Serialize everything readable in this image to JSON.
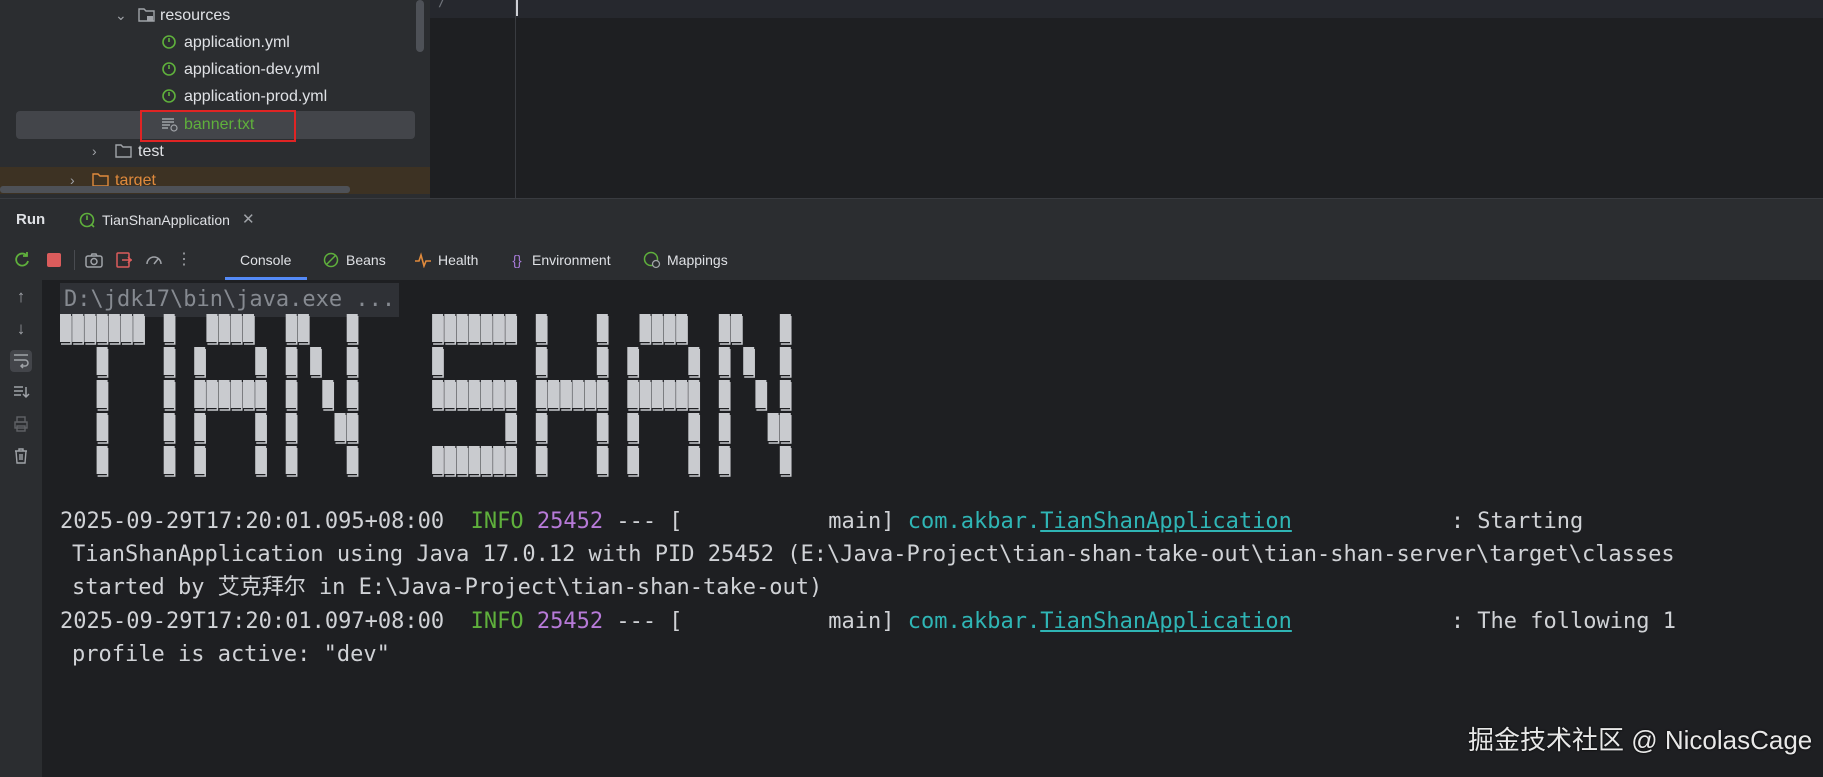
{
  "project_tree": {
    "items": [
      {
        "label": "resources",
        "kind": "folder-resources"
      },
      {
        "label": "application.yml",
        "kind": "yaml"
      },
      {
        "label": "application-dev.yml",
        "kind": "yaml"
      },
      {
        "label": "application-prod.yml",
        "kind": "yaml"
      },
      {
        "label": "banner.txt",
        "kind": "text",
        "selected": true
      },
      {
        "label": "test",
        "kind": "folder"
      },
      {
        "label": "target",
        "kind": "folder-excluded"
      }
    ]
  },
  "editor": {
    "first_char": "/"
  },
  "run_window": {
    "title": "Run",
    "tab_label": "TianShanApplication",
    "tool_tabs": [
      {
        "label": "Console",
        "icon": "console",
        "active": true
      },
      {
        "label": "Beans",
        "icon": "beans-icon"
      },
      {
        "label": "Health",
        "icon": "health-icon"
      },
      {
        "label": "Environment",
        "icon": "environment-icon"
      },
      {
        "label": "Mappings",
        "icon": "mappings-icon"
      }
    ]
  },
  "console": {
    "command": "D:\\jdk17\\bin\\java.exe ...",
    "banner_text": "TIAN SHAN",
    "log": [
      {
        "ts": "2025-09-29T17:20:01.095+08:00",
        "level": "INFO",
        "pid": "25452",
        "sep": "--- [",
        "thread": "           main]",
        "logger_pkg": "com.akbar.",
        "logger_class": "TianShanApplication",
        "msg": ": Starting"
      },
      {
        "cont": "TianShanApplication using Java 17.0.12 with PID 25452 (E:\\Java-Project\\tian-shan-take-out\\tian-shan-server\\target\\classes"
      },
      {
        "cont": "started by 艾克拜尔 in E:\\Java-Project\\tian-shan-take-out)"
      },
      {
        "ts": "2025-09-29T17:20:01.097+08:00",
        "level": "INFO",
        "pid": "25452",
        "sep": "--- [",
        "thread": "           main]",
        "logger_pkg": "com.akbar.",
        "logger_class": "TianShanApplication",
        "msg": ": The following 1"
      },
      {
        "cont": "profile is active: \"dev\""
      }
    ]
  },
  "watermark": "掘金技术社区 @ NicolasCage",
  "colors": {
    "accent": "#548af7",
    "info": "#5fb03c",
    "pid": "#b77ad8",
    "logger": "#2fb5b5",
    "highlight": "#e02424"
  }
}
